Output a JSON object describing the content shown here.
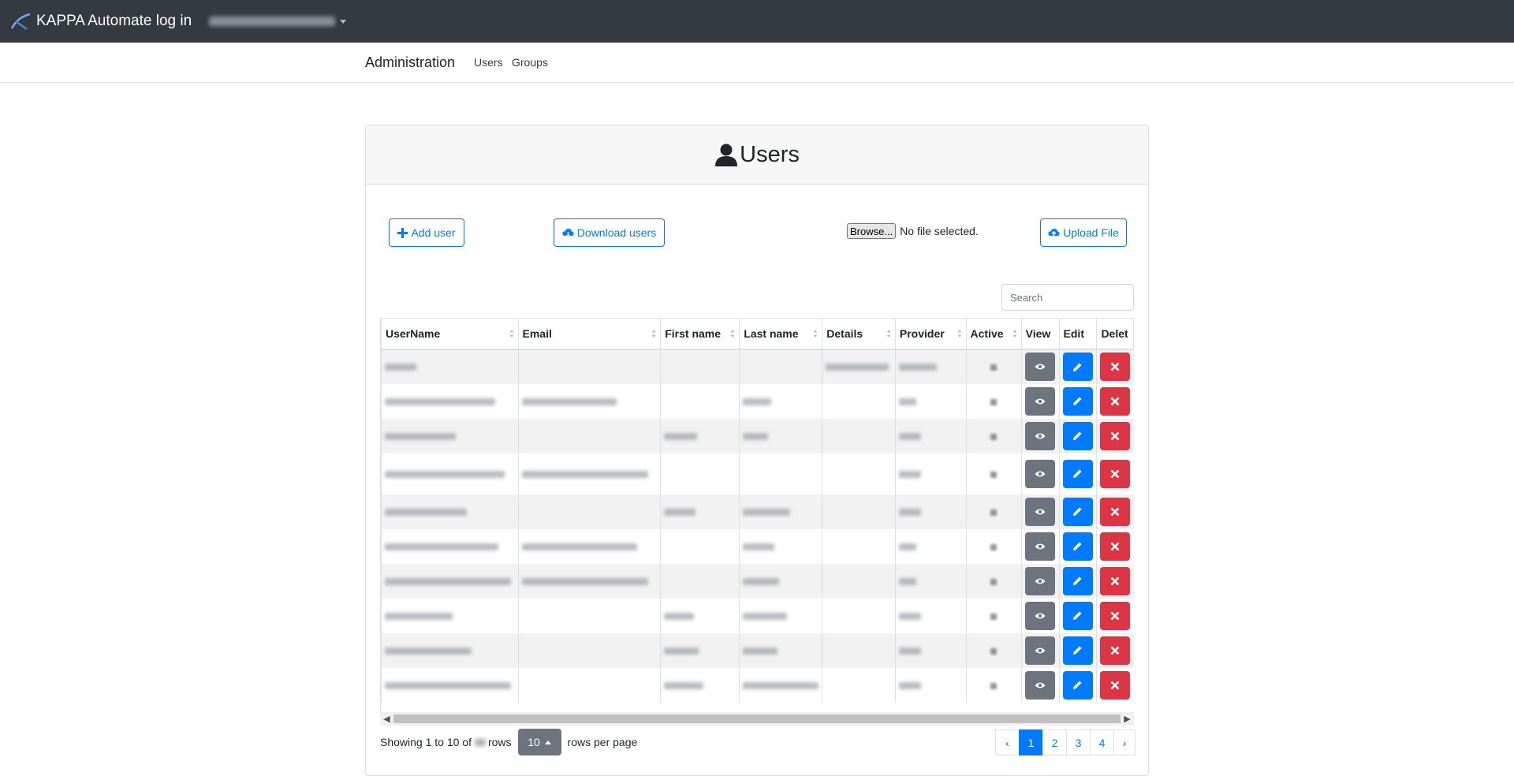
{
  "header": {
    "brand": "KAPPA Automate log in",
    "accent": "#343a40"
  },
  "subnav": {
    "title": "Administration",
    "links": [
      "Users",
      "Groups"
    ]
  },
  "card": {
    "title": "Users",
    "add_user": "Add user",
    "download_users": "Download users",
    "browse": "Browse...",
    "no_file": "No file selected.",
    "upload_file": "Upload File",
    "search_placeholder": "Search"
  },
  "table": {
    "columns": [
      "UserName",
      "Email",
      "First name",
      "Last name",
      "Details",
      "Provider",
      "Active",
      "View",
      "Edit",
      "Delet"
    ],
    "rows": [
      {
        "username": "",
        "email": "",
        "first": "",
        "last": "",
        "details": "",
        "provider": ""
      },
      {
        "username": "",
        "email": "",
        "first": "",
        "last": "",
        "details": "",
        "provider": ""
      },
      {
        "username": "",
        "email": "",
        "first": "",
        "last": "",
        "details": "",
        "provider": ""
      },
      {
        "username": "",
        "email": "",
        "first": "",
        "last": "",
        "details": "",
        "provider": ""
      },
      {
        "username": "",
        "email": "",
        "first": "",
        "last": "",
        "details": "",
        "provider": ""
      },
      {
        "username": "",
        "email": "",
        "first": "",
        "last": "",
        "details": "",
        "provider": ""
      },
      {
        "username": "",
        "email": "",
        "first": "",
        "last": "",
        "details": "",
        "provider": ""
      },
      {
        "username": "",
        "email": "",
        "first": "",
        "last": "",
        "details": "",
        "provider": ""
      },
      {
        "username": "",
        "email": "",
        "first": "",
        "last": "",
        "details": "",
        "provider": ""
      },
      {
        "username": "",
        "email": "",
        "first": "",
        "last": "",
        "details": "",
        "provider": ""
      }
    ]
  },
  "footer": {
    "showing": "Showing 1 to 10 of",
    "rows_label": "rows",
    "page_size": "10",
    "per_page": "rows per page",
    "prev": "‹",
    "next": "›",
    "pages": [
      "1",
      "2",
      "3",
      "4"
    ],
    "active_page": "1"
  },
  "colors": {
    "primary": "#007bff",
    "secondary": "#6c757d",
    "danger": "#dc3545"
  }
}
